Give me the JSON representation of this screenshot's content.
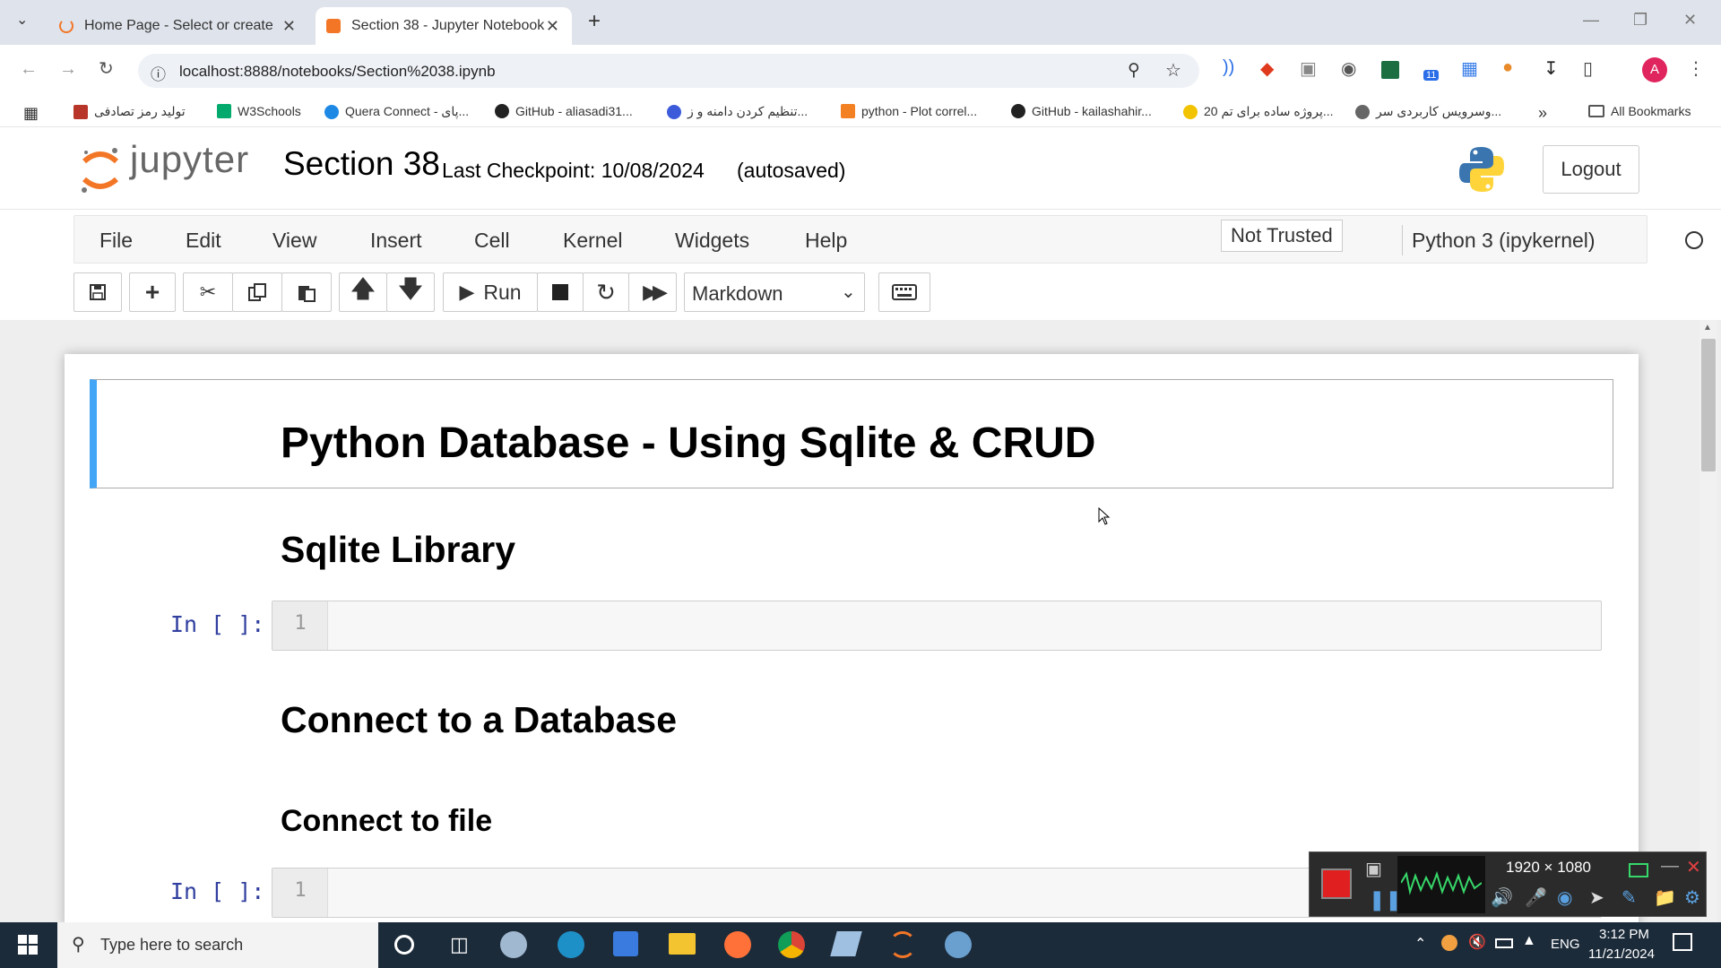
{
  "browser": {
    "tabs": [
      {
        "title": "Home Page - Select or create a",
        "active": false
      },
      {
        "title": "Section 38 - Jupyter Notebook",
        "active": true
      }
    ],
    "url": "localhost:8888/notebooks/Section%2038.ipynb",
    "bookmarks": [
      "تولید رمز تصادفی",
      "W3Schools",
      "Quera Connect - پای...",
      "GitHub - aliasadi31...",
      "تنظیم کردن دامنه و ز...",
      "python - Plot correl...",
      "GitHub - kailashahir...",
      "20 پروژه ساده برای تم...",
      "وسرویس کاربردی سر..."
    ],
    "all_bookmarks": "All Bookmarks",
    "profile_initial": "A",
    "ext_badge": "11"
  },
  "jupyter": {
    "logo_text": "jupyter",
    "notebook_title": "Section 38",
    "checkpoint": "Last Checkpoint: 10/08/2024",
    "autosaved": "(autosaved)",
    "logout": "Logout",
    "menu": [
      "File",
      "Edit",
      "View",
      "Insert",
      "Cell",
      "Kernel",
      "Widgets",
      "Help"
    ],
    "trust": "Not Trusted",
    "kernel": "Python 3 (ipykernel)",
    "run_label": "Run",
    "cell_type": "Markdown"
  },
  "notebook": {
    "h1": "Python Database - Using Sqlite & CRUD",
    "h2_a": "Sqlite Library",
    "prompt_1": "In [ ]:",
    "line_1": "1",
    "h2_b": "Connect to a Database",
    "h3_a": "Connect to file",
    "prompt_2": "In [ ]:",
    "line_2": "1"
  },
  "recorder": {
    "resolution": "1920 × 1080"
  },
  "taskbar": {
    "search_placeholder": "Type here to search",
    "lang": "ENG",
    "time": "3:12 PM",
    "date": "11/21/2024"
  }
}
